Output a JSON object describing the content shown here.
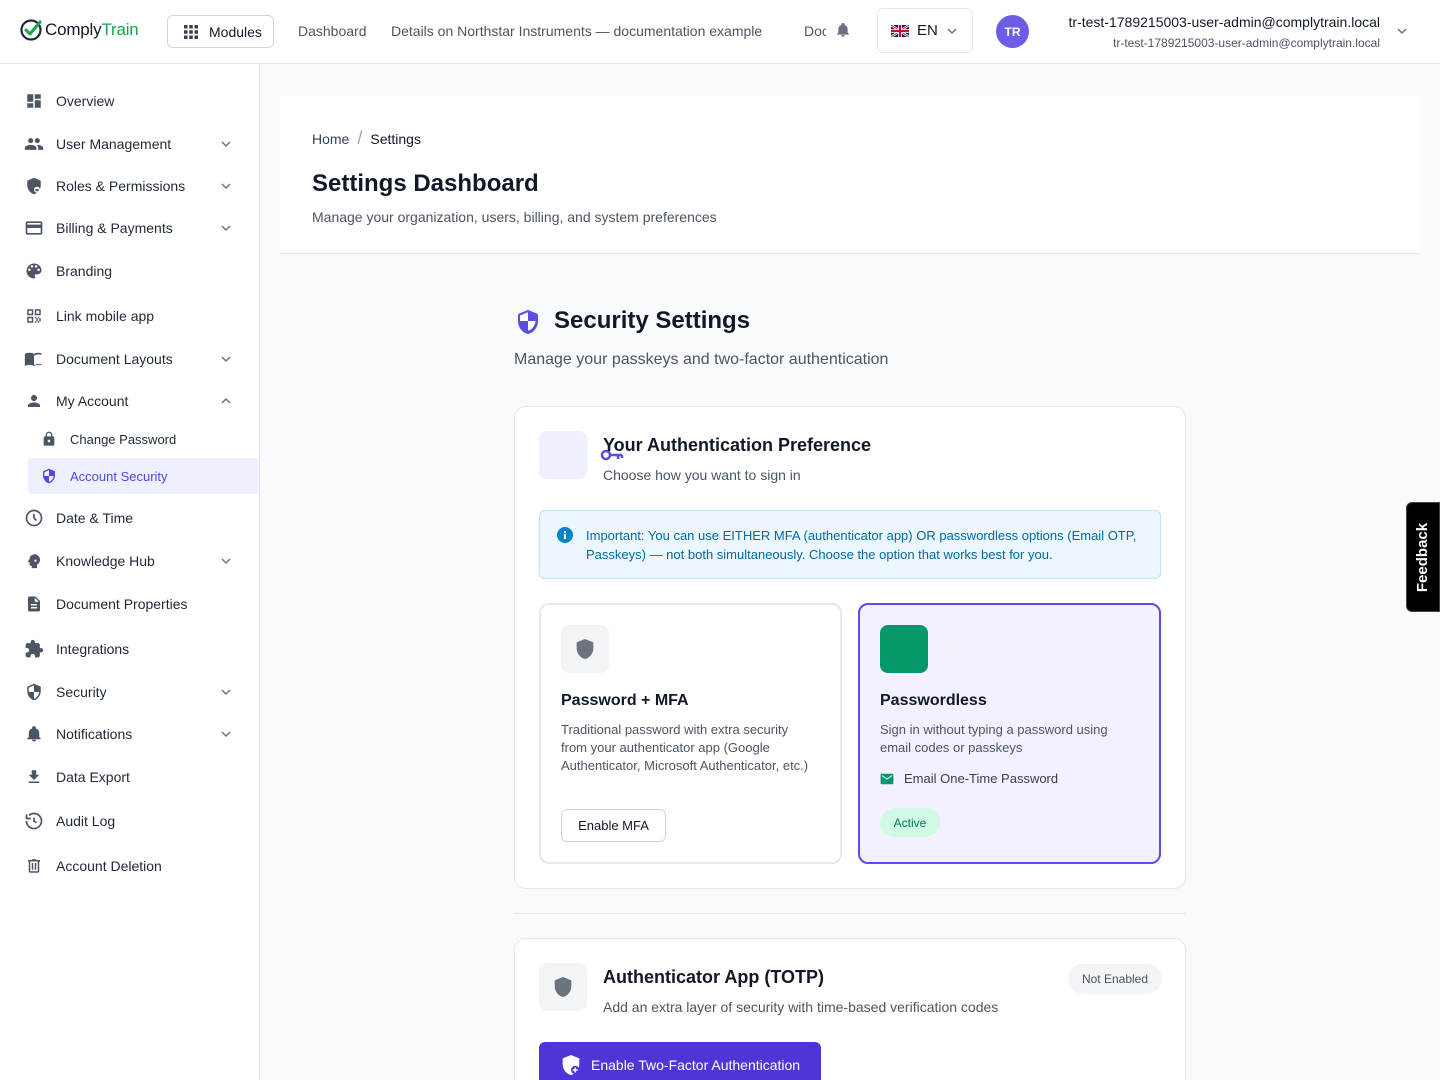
{
  "brand": {
    "name_part1": "Comply",
    "name_part2": "Train",
    "accent": "#16a34a"
  },
  "topbar": {
    "modules_label": "Modules",
    "nav": [
      "Dashboard",
      "Details on Northstar Instruments — documentation example",
      "Documentation"
    ],
    "language": "EN",
    "user_initials": "TR",
    "user_name": "tr-test-1789215003-user-admin@complytrain.local",
    "user_email": "tr-test-1789215003-user-admin@complytrain.local"
  },
  "sidebar": {
    "items": [
      {
        "label": "Overview",
        "icon": "dashboard-icon"
      },
      {
        "label": "User Management",
        "icon": "users-icon",
        "expandable": true
      },
      {
        "label": "Roles & Permissions",
        "icon": "shield-lock-icon",
        "expandable": true
      },
      {
        "label": "Billing & Payments",
        "icon": "credit-card-icon",
        "expandable": true
      },
      {
        "label": "Branding",
        "icon": "palette-icon"
      },
      {
        "label": "Link mobile app",
        "icon": "qr-code-icon"
      },
      {
        "label": "Document Layouts",
        "icon": "book-icon",
        "expandable": true
      },
      {
        "label": "My Account",
        "icon": "person-icon",
        "expandable": true,
        "expanded": true
      },
      {
        "label": "Change Password",
        "icon": "lock-icon",
        "sub": true
      },
      {
        "label": "Account Security",
        "icon": "shield-icon",
        "sub": true,
        "active": true
      },
      {
        "label": "Date & Time",
        "icon": "clock-icon"
      },
      {
        "label": "Knowledge Hub",
        "icon": "psychology-icon",
        "expandable": true
      },
      {
        "label": "Document Properties",
        "icon": "document-icon"
      },
      {
        "label": "Integrations",
        "icon": "puzzle-icon"
      },
      {
        "label": "Security",
        "icon": "security-icon",
        "expandable": true
      },
      {
        "label": "Notifications",
        "icon": "bell-icon",
        "expandable": true
      },
      {
        "label": "Data Export",
        "icon": "download-icon"
      },
      {
        "label": "Audit Log",
        "icon": "history-icon"
      },
      {
        "label": "Account Deletion",
        "icon": "trash-icon"
      }
    ]
  },
  "header": {
    "breadcrumb_home": "Home",
    "breadcrumb_separator": "/",
    "breadcrumb_current": "Settings",
    "title": "Settings Dashboard",
    "subtitle": "Manage your organization, users, billing, and system preferences"
  },
  "security": {
    "title": "Security Settings",
    "subtitle": "Manage your passkeys and two-factor authentication"
  },
  "preference": {
    "title": "Your Authentication Preference",
    "subtitle": "Choose how you want to sign in",
    "info": "Important: You can use EITHER MFA (authenticator app) OR passwordless options (Email OTP, Passkeys) — not both simultaneously. Choose the option that works best for you.",
    "option_mfa": {
      "title": "Password + MFA",
      "description": "Traditional password with extra security from your authenticator app (Google Authenticator, Microsoft Authenticator, etc.)",
      "button": "Enable MFA"
    },
    "option_passwordless": {
      "title": "Passwordless",
      "description": "Sign in without typing a password using email codes or passkeys",
      "method": "Email One-Time Password",
      "status": "Active",
      "accent": "#5b4fe0"
    }
  },
  "totp": {
    "title": "Authenticator App (TOTP)",
    "subtitle": "Add an extra layer of security with time-based verification codes",
    "status": "Not Enabled",
    "button": "Enable Two-Factor Authentication"
  },
  "feedback_label": "Feedback"
}
